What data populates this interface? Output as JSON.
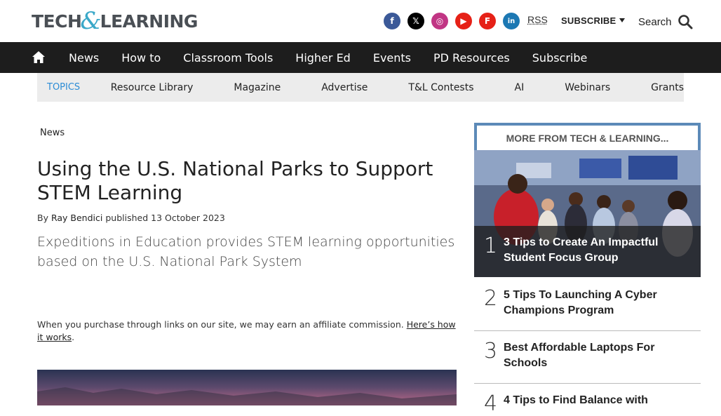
{
  "site": {
    "logo_part1": "TECH",
    "logo_amp": "&",
    "logo_part2": "LEARNING"
  },
  "header": {
    "socials": [
      {
        "name": "facebook-icon",
        "glyph": "f"
      },
      {
        "name": "x-icon",
        "glyph": "𝕏"
      },
      {
        "name": "instagram-icon",
        "glyph": "◎"
      },
      {
        "name": "youtube-icon",
        "glyph": "▶"
      },
      {
        "name": "flipboard-icon",
        "glyph": "F"
      },
      {
        "name": "linkedin-icon",
        "glyph": "in"
      }
    ],
    "rss_label": "RSS",
    "subscribe_label": "SUBSCRIBE",
    "search_label": "Search"
  },
  "nav": {
    "items": [
      "News",
      "How to",
      "Classroom Tools",
      "Higher Ed",
      "Events",
      "PD Resources",
      "Subscribe"
    ]
  },
  "topics": {
    "label": "TOPICS",
    "items": [
      "Resource Library",
      "Magazine",
      "Advertise",
      "T&L Contests",
      "AI",
      "Webinars",
      "Grants"
    ]
  },
  "article": {
    "breadcrumb": "News",
    "title": "Using the U.S. National Parks to Support STEM Learning",
    "by": "By",
    "author": "Ray Bendici",
    "published": "published 13 October 2023",
    "subhead": "Expeditions in Education provides STEM learning opportunities based on the U.S. National Park System",
    "affiliate_text": "When you purchase through links on our site, we may earn an affiliate commission.",
    "affiliate_link": "Here’s how it works",
    "affiliate_end": "."
  },
  "sidebar": {
    "heading": "MORE FROM TECH & LEARNING...",
    "stories": [
      {
        "rank": "1",
        "title": "3 Tips to Create An Impactful Student Focus Group"
      },
      {
        "rank": "2",
        "title": "5 Tips To Launching A Cyber Champions Program"
      },
      {
        "rank": "3",
        "title": "Best Affordable Laptops For Schools"
      },
      {
        "rank": "4",
        "title": "4 Tips to Find Balance with"
      }
    ]
  },
  "colors": {
    "nav_bg": "#1d1d1d",
    "topics_accent": "#2b8cd6",
    "sidebar_border": "#5c8ab8"
  }
}
